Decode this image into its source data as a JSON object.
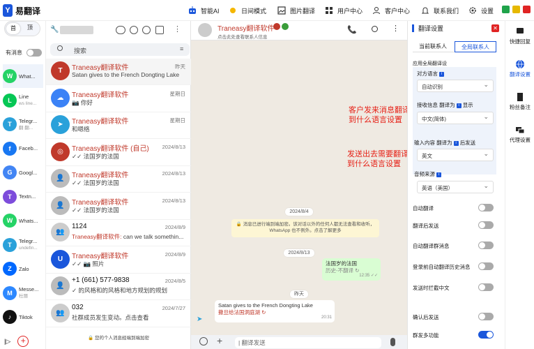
{
  "app": {
    "title": "易翻译",
    "logo_letter": "Y"
  },
  "topnav": [
    {
      "key": "ai",
      "label": "智能AI"
    },
    {
      "key": "day",
      "label": "日间模式"
    },
    {
      "key": "img",
      "label": "图片翻译"
    },
    {
      "key": "user",
      "label": "用户中心"
    },
    {
      "key": "service",
      "label": "客户中心"
    },
    {
      "key": "contact",
      "label": "联系我们"
    },
    {
      "key": "settings",
      "label": "设置"
    }
  ],
  "window_controls": {
    "colors": [
      "#1fa34a",
      "#e6b800",
      "#e02424"
    ]
  },
  "leftbar": {
    "tab_first": "首",
    "tab_second": "顶",
    "msg_toggle_label": "有消息",
    "items": [
      {
        "name": "What...",
        "sub": "",
        "color": "#25d366",
        "glyph": "W"
      },
      {
        "name": "Line",
        "sub": "ws line...",
        "color": "#06c755",
        "glyph": "L"
      },
      {
        "name": "Telegr...",
        "sub": "翻 翻...",
        "color": "#2aa1da",
        "glyph": "T"
      },
      {
        "name": "Faceb...",
        "sub": "",
        "color": "#1877f2",
        "glyph": "f"
      },
      {
        "name": "Googl...",
        "sub": "",
        "color": "#4285f4",
        "glyph": "G"
      },
      {
        "name": "Textn...",
        "sub": "",
        "color": "#7d4cdb",
        "glyph": "T"
      },
      {
        "name": "Whats...",
        "sub": "",
        "color": "#25d366",
        "glyph": "W"
      },
      {
        "name": "Telegr...",
        "sub": "undefin...",
        "color": "#2aa1da",
        "glyph": "T"
      },
      {
        "name": "Zalo",
        "sub": "",
        "color": "#0068ff",
        "glyph": "Z"
      },
      {
        "name": "Messe...",
        "sub": "杜丽",
        "color": "#2d88ff",
        "glyph": "M"
      },
      {
        "name": "Tiktok",
        "sub": "",
        "color": "#111111",
        "glyph": "♪"
      }
    ]
  },
  "chatlist": {
    "search_placeholder": "搜索",
    "rows": [
      {
        "name": "Traneasy翻译软件",
        "time": "昨天",
        "preview": "Satan gives to the French Dongting Lake",
        "color": "#c0392b",
        "glyph": "T",
        "name_dark": false
      },
      {
        "name": "Traneasy翻译软件",
        "time": "星期日",
        "preview": "📷 你好",
        "color": "#3b82f6",
        "glyph": "☁",
        "name_dark": false
      },
      {
        "name": "Traneasy翻译软件",
        "time": "星期日",
        "preview": "和嗯络",
        "color": "#2aa1da",
        "glyph": "➤",
        "name_dark": false
      },
      {
        "name": "Traneasy翻译软件 (自己)",
        "time": "2024/8/13",
        "preview": "✓✓ 法国岁的法国",
        "color": "#c0392b",
        "glyph": "◎",
        "name_dark": false
      },
      {
        "name": "Traneasy翻译软件",
        "time": "2024/8/13",
        "preview": "✓✓ 法国岁的法国",
        "color": "#bbbbbb",
        "glyph": "👤",
        "name_dark": false
      },
      {
        "name": "Traneasy翻译软件",
        "time": "2024/8/13",
        "preview": "✓✓ 法国岁的法国",
        "color": "#bbbbbb",
        "glyph": "👤",
        "name_dark": false
      },
      {
        "name": "1124",
        "time": "2024/8/9",
        "preview_prefix": "Traneasy翻译软件:",
        "preview": " can we talk somethin...",
        "color": "#cccccc",
        "glyph": "👥",
        "name_dark": true
      },
      {
        "name": "Traneasy翻译软件",
        "time": "2024/8/9",
        "preview": "✓✓ 📷 照片",
        "color": "#1a56db",
        "glyph": "U",
        "name_dark": false
      },
      {
        "name": "+1 (661) 577-9838",
        "time": "2024/8/5",
        "preview": "✓ 的风格和的风格和地方规划的规划",
        "color": "#bbbbbb",
        "glyph": "👤",
        "name_dark": true
      },
      {
        "name": "032",
        "time": "2024/7/27",
        "preview": "社群成员发生变动。点击查看",
        "color": "#cccccc",
        "glyph": "👥",
        "name_dark": true
      }
    ],
    "enc_note": "🔒 您的个人消息经端到端加密"
  },
  "conversation": {
    "contact_name": "Traneasy翻译软件",
    "contact_sub": "点击此处查看联系人信息",
    "date1": "2024/8/4",
    "sys_note": "🔒 消息已进行端到端加密。该对话以外的任何人都无法查看和收听，WhatsApp 也不例外。点击了解更多",
    "date2": "2024/8/13",
    "out_text": "法国岁的法国",
    "out_sub": "历史-不翻译 ↻",
    "out_time": "12:35 ✓✓",
    "date3": "昨天",
    "in_text": "Satan gives to the French Dongting Lake",
    "in_sub": "撒旦给法国洞庭湖 ↻",
    "in_time": "20:31",
    "input_placeholder": "| 翻译发送",
    "annot1": "客户发来消息翻译到什么语言设置",
    "annot2": "发送出去需要翻译到什么语言设置"
  },
  "panel": {
    "title": "翻译设置",
    "tab1": "当前联系人",
    "tab2": "全局联系人",
    "section": "应用全局翻译设",
    "lang_label": "对方语言",
    "lang_value": "自动识别",
    "recv_label": "接收信息 翻译为",
    "recv_show": "显示",
    "recv_value": "中文(简体)",
    "input_label": "输入内容 翻译为",
    "input_after": "后发送",
    "input_value": "英文",
    "audio_label": "音频来源",
    "audio_value": "英语（美国）",
    "toggles": [
      {
        "label": "自动翻译",
        "on": false
      },
      {
        "label": "翻译后发送",
        "on": false
      },
      {
        "label": "自动翻译群消息",
        "on": false
      },
      {
        "label": "登录前自动翻译历史消息",
        "on": false
      },
      {
        "label": "发送时拦截中文",
        "on": false
      },
      {
        "label": "确认后发送",
        "on": false
      },
      {
        "label": "群发多功能",
        "on": true
      }
    ]
  },
  "rightbar": {
    "items": [
      {
        "label": "快捷回复"
      },
      {
        "label": "翻译设置"
      },
      {
        "label": "粉丝备注"
      },
      {
        "label": "代理设置"
      }
    ]
  }
}
